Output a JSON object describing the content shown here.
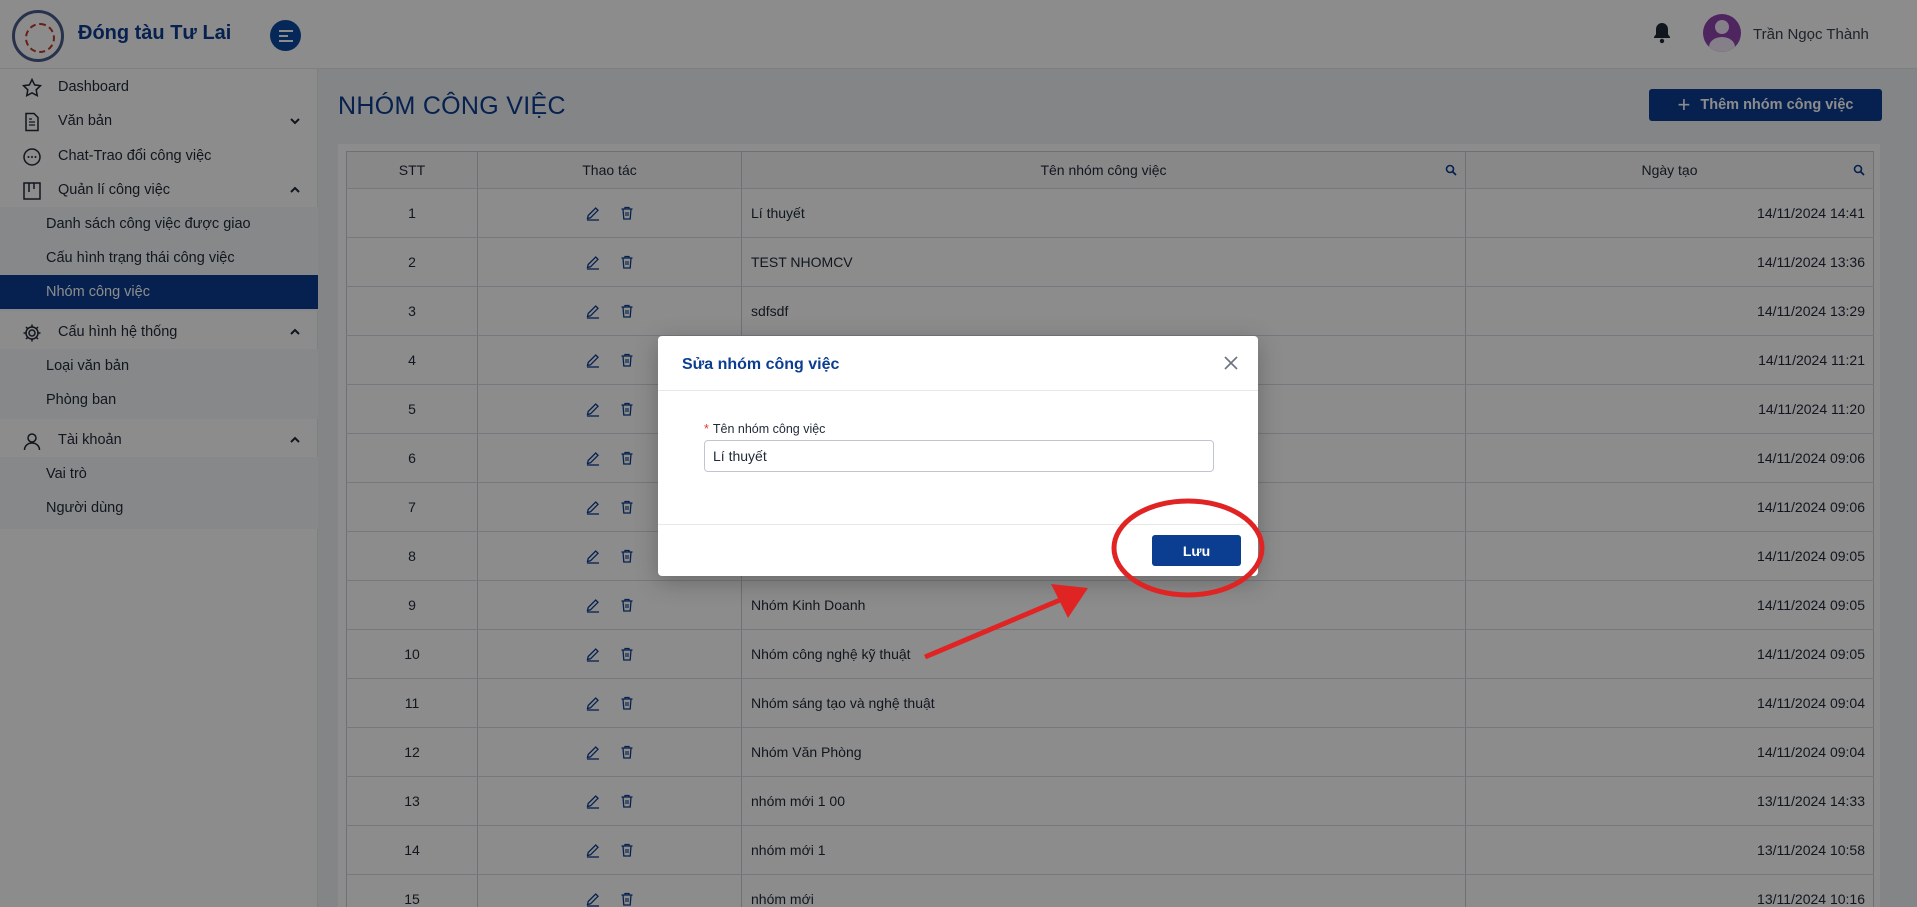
{
  "header": {
    "brand": "Đóng tàu Tư Lai",
    "user_name": "Trần Ngọc Thành"
  },
  "sidebar": {
    "items": [
      {
        "label": "Dashboard",
        "icon": "star-icon"
      },
      {
        "label": "Văn bản",
        "icon": "document-icon"
      },
      {
        "label": "Chat-Trao đổi công việc",
        "icon": "chat-icon"
      },
      {
        "label": "Quản lí công việc",
        "icon": "kanban-icon"
      },
      {
        "label": "Cấu hình hệ thống",
        "icon": "gear-icon"
      },
      {
        "label": "Tài khoản",
        "icon": "user-icon"
      }
    ],
    "work_sub": [
      {
        "label": "Danh sách công việc được giao"
      },
      {
        "label": "Cấu hình trạng thái công việc"
      },
      {
        "label": "Nhóm công việc",
        "active": true
      }
    ],
    "system_sub": [
      {
        "label": "Loại văn bản"
      },
      {
        "label": "Phòng ban"
      }
    ],
    "account_sub": [
      {
        "label": "Vai trò"
      },
      {
        "label": "Người dùng"
      }
    ]
  },
  "main": {
    "title": "NHÓM CÔNG VIỆC",
    "add_button": "Thêm nhóm công việc",
    "columns": [
      "STT",
      "Thao tác",
      "Tên nhóm công việc",
      "Ngày tạo"
    ],
    "rows": [
      {
        "stt": "1",
        "name": "Lí thuyết",
        "date": "14/11/2024 14:41"
      },
      {
        "stt": "2",
        "name": "TEST NHOMCV",
        "date": "14/11/2024 13:36"
      },
      {
        "stt": "3",
        "name": "sdfsdf",
        "date": "14/11/2024 13:29"
      },
      {
        "stt": "4",
        "name": "",
        "date": "14/11/2024 11:21"
      },
      {
        "stt": "5",
        "name": "",
        "date": "14/11/2024 11:20"
      },
      {
        "stt": "6",
        "name": "",
        "date": "14/11/2024 09:06"
      },
      {
        "stt": "7",
        "name": "",
        "date": "14/11/2024 09:06"
      },
      {
        "stt": "8",
        "name": "",
        "date": "14/11/2024 09:05"
      },
      {
        "stt": "9",
        "name": "Nhóm Kinh Doanh",
        "date": "14/11/2024 09:05"
      },
      {
        "stt": "10",
        "name": "Nhóm công nghệ kỹ thuật",
        "date": "14/11/2024 09:05"
      },
      {
        "stt": "11",
        "name": "Nhóm sáng tạo và nghệ thuật",
        "date": "14/11/2024 09:04"
      },
      {
        "stt": "12",
        "name": "Nhóm Văn Phòng",
        "date": "14/11/2024 09:04"
      },
      {
        "stt": "13",
        "name": "nhóm mới 1 00",
        "date": "13/11/2024 14:33"
      },
      {
        "stt": "14",
        "name": "nhóm mới 1",
        "date": "13/11/2024 10:58"
      },
      {
        "stt": "15",
        "name": "nhóm mới",
        "date": "13/11/2024 10:16"
      }
    ]
  },
  "modal": {
    "title": "Sửa nhóm công việc",
    "field_label": "Tên nhóm công việc",
    "required_mark": "*",
    "field_value": "Lí thuyết",
    "save_label": "Lưu"
  },
  "colors": {
    "primary": "#0b3d91",
    "annotation": "#e02424"
  }
}
